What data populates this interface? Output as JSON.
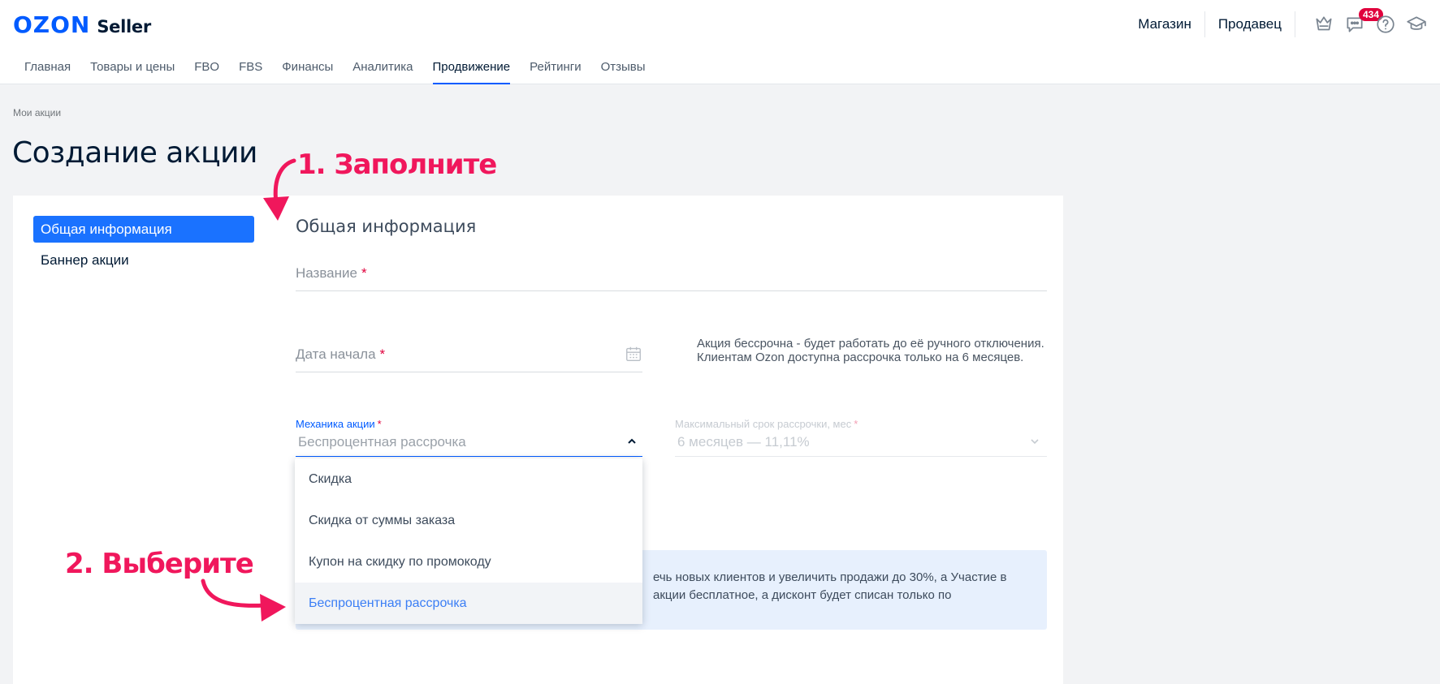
{
  "header": {
    "logo_brand": "OZON",
    "logo_product": "Seller",
    "links": [
      "Магазин",
      "Продавец"
    ],
    "notifications_count": "434",
    "icons": [
      "crown-icon",
      "chat-icon",
      "help-icon",
      "graduation-cap-icon"
    ]
  },
  "nav": {
    "items": [
      "Главная",
      "Товары и цены",
      "FBO",
      "FBS",
      "Финансы",
      "Аналитика",
      "Продвижение",
      "Рейтинги",
      "Отзывы"
    ],
    "active": "Продвижение"
  },
  "breadcrumb": "Мои акции",
  "page_title": "Создание акции",
  "sidebar": {
    "items": [
      "Общая информация",
      "Баннер акции"
    ]
  },
  "form": {
    "section_title": "Общая информация",
    "name_label": "Название",
    "start_date_label": "Дата начала",
    "required_mark": "*",
    "note": "Акция бессрочна - будет работать до её ручного отключения. Клиентам Ozon доступна рассрочка только на 6 месяцев.",
    "mechanics_label": "Механика акции",
    "mechanics_value": "Беспроцентная рассрочка",
    "max_term_label": "Максимальный срок рассрочки, мес",
    "max_term_value": "6 месяцев — 11,11%",
    "info_text": "ечь новых клиентов и увеличить продажи до 30%, а Участие в акции бесплатное, а дисконт будет списан только по"
  },
  "dropdown": {
    "options": [
      "Скидка",
      "Скидка от суммы заказа",
      "Купон на скидку по промокоду",
      "Беспроцентная рассрочка"
    ],
    "selected": "Беспроцентная рассрочка"
  },
  "annotations": {
    "step1": "1. Заполните",
    "step2": "2. Выберите",
    "color": "#f0175c"
  },
  "colors": {
    "brand": "#005bff",
    "active_side": "#1a72ff",
    "required": "#e0003c"
  }
}
